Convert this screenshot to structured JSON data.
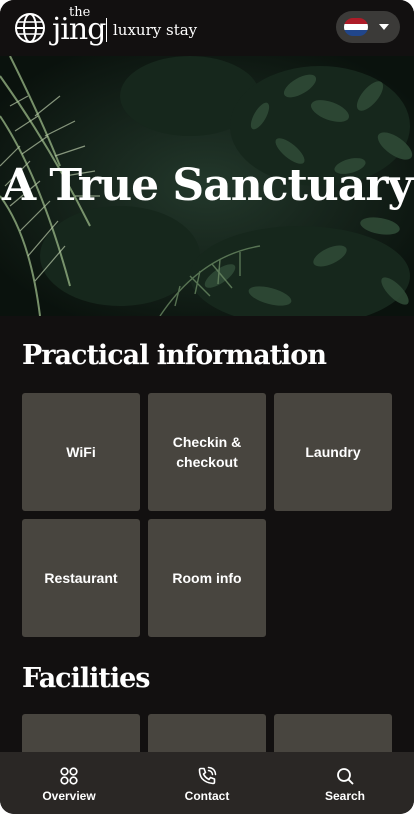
{
  "header": {
    "brand_small": "the",
    "brand_name": "jing",
    "brand_tagline": "luxury stay",
    "language": {
      "flag": "netherlands-flag",
      "flag_colors": [
        "#ae1c28",
        "#ffffff",
        "#21468b"
      ]
    }
  },
  "hero": {
    "title": "A True Sanctuary"
  },
  "practical": {
    "title": "Practical information",
    "tiles": [
      {
        "label": "WiFi"
      },
      {
        "label": "Checkin & checkout"
      },
      {
        "label": "Laundry"
      },
      {
        "label": "Restaurant"
      },
      {
        "label": "Room info"
      }
    ]
  },
  "facilities": {
    "title": "Facilities"
  },
  "nav": {
    "items": [
      {
        "label": "Overview",
        "icon": "grid-icon"
      },
      {
        "label": "Contact",
        "icon": "phone-icon"
      },
      {
        "label": "Search",
        "icon": "search-icon"
      }
    ]
  },
  "colors": {
    "background": "#121010",
    "tile": "#48453f",
    "nav": "#2a2725",
    "text": "#ffffff"
  }
}
